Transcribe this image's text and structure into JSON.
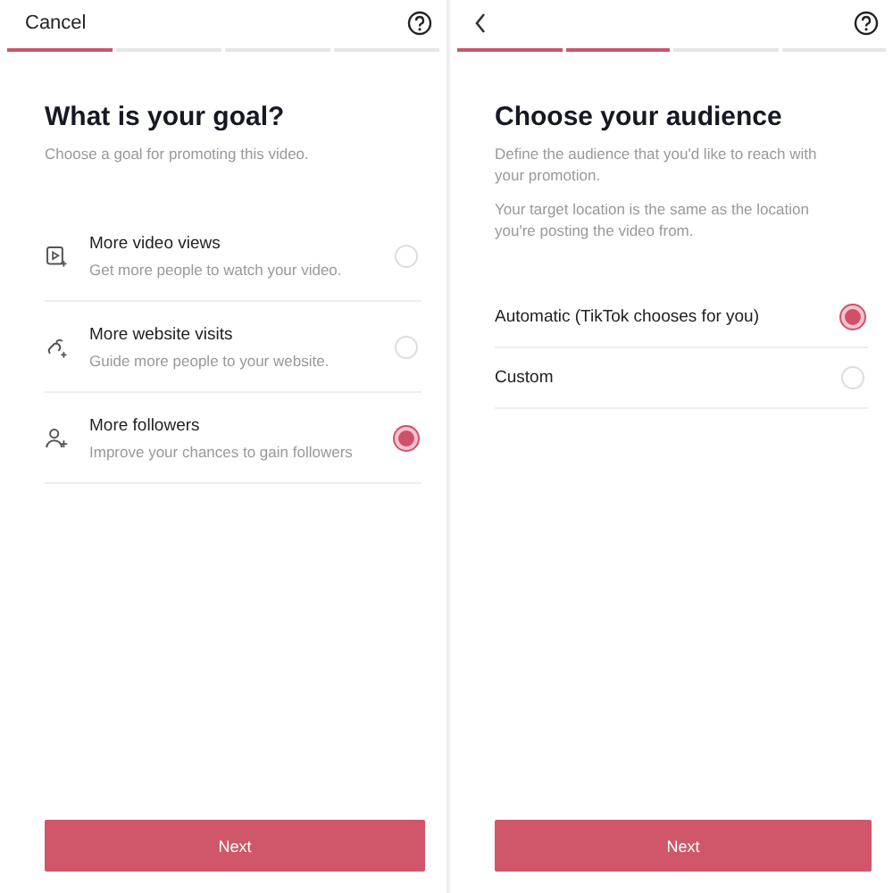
{
  "panels": [
    {
      "back": false,
      "cancel": "Cancel",
      "progress": [
        {
          "completed": true
        },
        {
          "completed": false
        },
        {
          "completed": false
        },
        {
          "completed": false
        }
      ],
      "title": "What is your goal?",
      "descriptions": [
        "Choose a goal for promoting this video."
      ],
      "options": [
        {
          "kind": "video",
          "label": "More video views",
          "sublabel": "Get more people to watch your video.",
          "selected": false
        },
        {
          "kind": "link",
          "label": "More website visits",
          "sublabel": "Guide more people to your website.",
          "selected": false
        },
        {
          "kind": "person",
          "label": "More followers",
          "sublabel": "Improve your chances to gain followers",
          "selected": true
        }
      ],
      "button": "Next"
    },
    {
      "back": true,
      "progress": [
        {
          "completed": true
        },
        {
          "completed": true
        },
        {
          "completed": false
        },
        {
          "completed": false
        }
      ],
      "title": "Choose your audience",
      "descriptions": [
        "Define the audience that you'd like to reach with your promotion.",
        "Your target location is the same as the location you're posting the video from."
      ],
      "options": [
        {
          "label": "Automatic (TikTok chooses for you)",
          "selected": true
        },
        {
          "label": "Custom",
          "selected": false
        }
      ],
      "button": "Next"
    }
  ]
}
